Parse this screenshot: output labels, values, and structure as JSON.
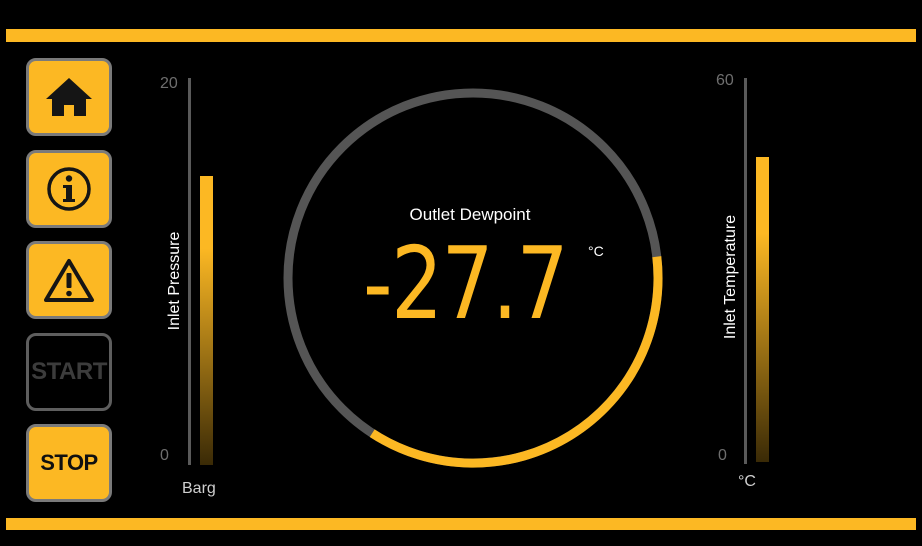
{
  "colors": {
    "accent": "#fcb823",
    "track": "#555555",
    "background": "#000000"
  },
  "sidebar": {
    "buttons": [
      {
        "name": "home",
        "icon": "home-icon",
        "state": "active"
      },
      {
        "name": "info",
        "icon": "info-icon",
        "state": "active"
      },
      {
        "name": "alarm",
        "icon": "warning-icon",
        "state": "active"
      },
      {
        "name": "start",
        "label": "START",
        "state": "disabled"
      },
      {
        "name": "stop",
        "label": "STOP",
        "state": "active"
      }
    ]
  },
  "inlet_pressure": {
    "label": "Inlet Pressure",
    "unit": "Barg",
    "min": "0",
    "max": "20",
    "level_fraction": 0.76
  },
  "inlet_temperature": {
    "label": "Inlet Temperature",
    "unit": "°C",
    "min": "0",
    "max": "60",
    "level_fraction": 0.81
  },
  "dewpoint": {
    "title": "Outlet Dewpoint",
    "value": "-27.7",
    "unit": "°C",
    "arc_fraction": 0.36
  }
}
